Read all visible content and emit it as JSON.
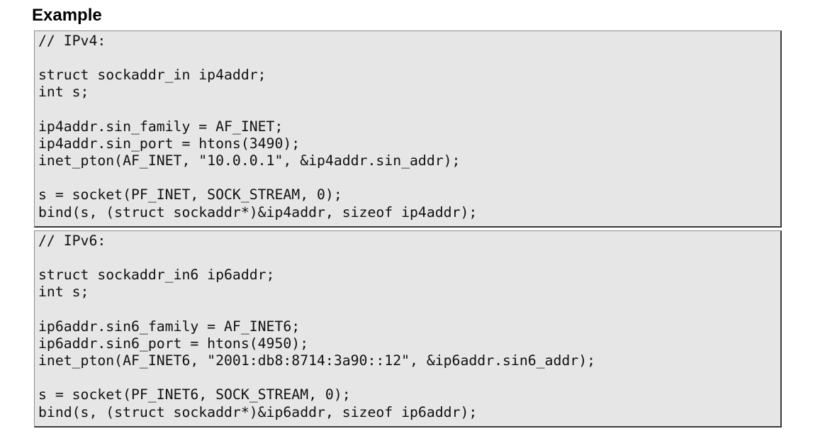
{
  "section": {
    "title": "Example"
  },
  "code_blocks": [
    {
      "text": "// IPv4:\n\nstruct sockaddr_in ip4addr;\nint s;\n\nip4addr.sin_family = AF_INET;\nip4addr.sin_port = htons(3490);\ninet_pton(AF_INET, \"10.0.0.1\", &ip4addr.sin_addr);\n\ns = socket(PF_INET, SOCK_STREAM, 0);\nbind(s, (struct sockaddr*)&ip4addr, sizeof ip4addr);"
    },
    {
      "text": "// IPv6:\n\nstruct sockaddr_in6 ip6addr;\nint s;\n\nip6addr.sin6_family = AF_INET6;\nip6addr.sin6_port = htons(4950);\ninet_pton(AF_INET6, \"2001:db8:8714:3a90::12\", &ip6addr.sin6_addr);\n\ns = socket(PF_INET6, SOCK_STREAM, 0);\nbind(s, (struct sockaddr*)&ip6addr, sizeof ip6addr);"
    }
  ],
  "colors": {
    "code_background": "#e6e6e6",
    "code_border_dark": "#3a3a3a",
    "code_border_light": "#8a8a8a"
  }
}
